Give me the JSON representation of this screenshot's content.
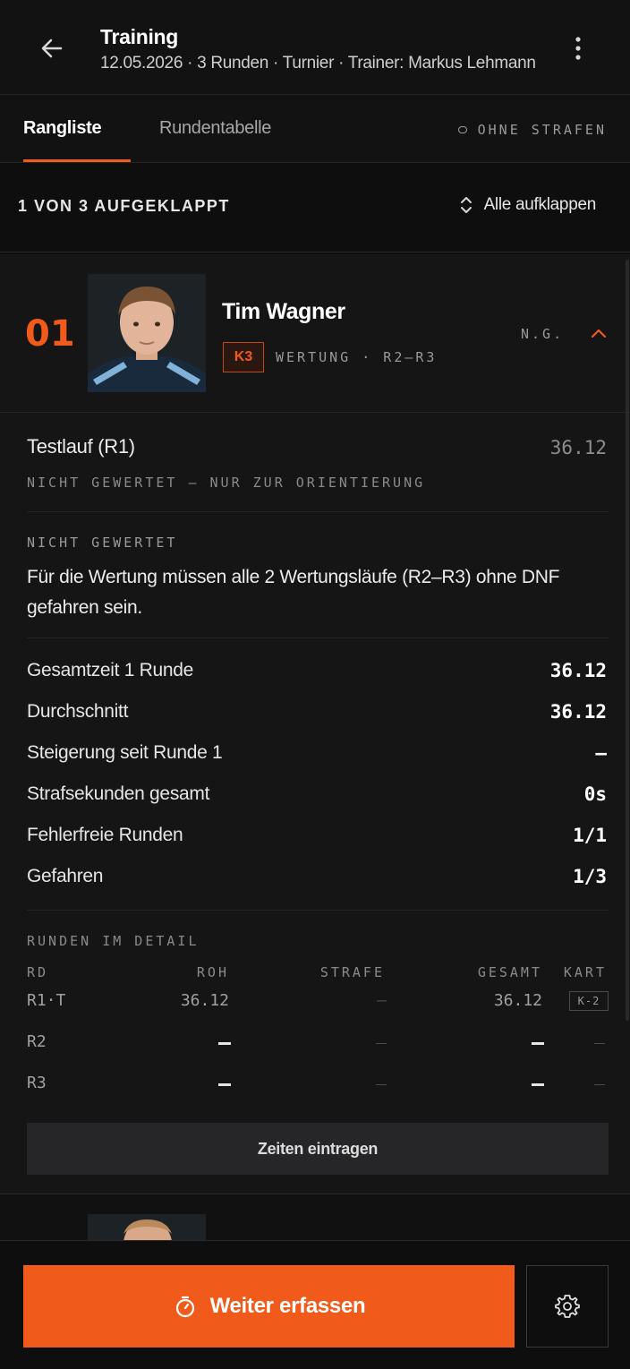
{
  "header": {
    "title": "Training",
    "subtitle": "12.05.2026 · 3 Runden · Turnier · Trainer: Markus Lehmann"
  },
  "tabs": {
    "rangliste": "Rangliste",
    "rundentabelle": "Rundentabelle",
    "strafen_toggle": "OHNE STRAFEN"
  },
  "expand": {
    "count": "1 VON 3 AUFGEKLAPPT",
    "button": "Alle aufklappen"
  },
  "driver": {
    "rank": "01",
    "name": "Tim Wagner",
    "class_badge": "K3",
    "wertung": "WERTUNG · R2–R3",
    "status": "N.G."
  },
  "testlauf": {
    "label": "Testlauf (R1)",
    "time": "36.12",
    "note": "NICHT GEWERTET — NUR ZUR ORIENTIERUNG"
  },
  "not_rated": {
    "label": "NICHT GEWERTET",
    "text": "Für die Wertung müssen alle 2 Wertungsläufe (R2–R3) ohne DNF gefahren sein."
  },
  "stats": [
    {
      "label": "Gesamtzeit 1 Runde",
      "value": "36.12"
    },
    {
      "label": "Durchschnitt",
      "value": "36.12"
    },
    {
      "label": "Steigerung seit Runde 1",
      "value": "—"
    },
    {
      "label": "Strafsekunden gesamt",
      "value": "0s"
    },
    {
      "label": "Fehlerfreie Runden",
      "value": "1/1"
    },
    {
      "label": "Gefahren",
      "value": "1/3"
    }
  ],
  "runden": {
    "title": "RUNDEN IM DETAIL",
    "headers": {
      "rd": "RD",
      "roh": "ROH",
      "strafe": "STRAFE",
      "gesamt": "GESAMT",
      "kart": "KART"
    },
    "rows": [
      {
        "rd": "R1·T",
        "roh": "36.12",
        "strafe": "—",
        "gesamt": "36.12",
        "kart": "K-2"
      },
      {
        "rd": "R2"
      },
      {
        "rd": "R3"
      }
    ]
  },
  "zeiten_button": "Zeiten eintragen",
  "footer": {
    "primary": "Weiter erfassen"
  },
  "colors": {
    "accent": "#f05a1a",
    "background": "#0e0e0f",
    "card": "#151516"
  }
}
